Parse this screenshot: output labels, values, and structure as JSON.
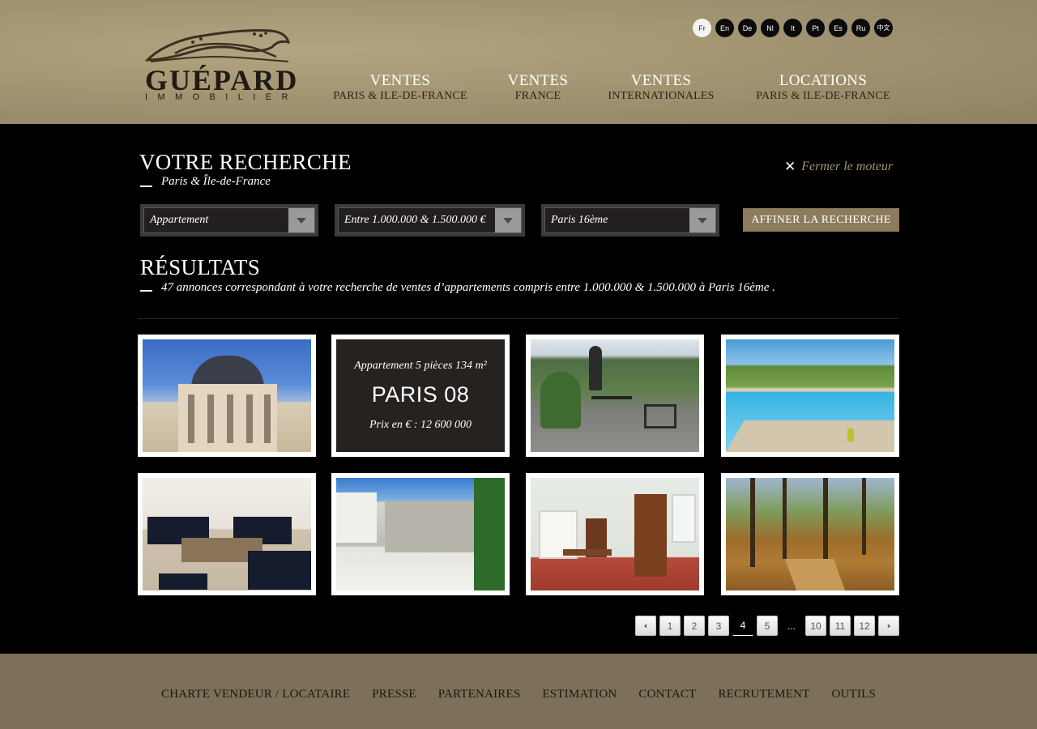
{
  "header": {
    "logo": {
      "name": "GUÉPARD",
      "tagline": "IMMOBILIER"
    },
    "languages": [
      {
        "code": "Fr",
        "active": true
      },
      {
        "code": "En",
        "active": false
      },
      {
        "code": "De",
        "active": false
      },
      {
        "code": "Nl",
        "active": false
      },
      {
        "code": "It",
        "active": false
      },
      {
        "code": "Pt",
        "active": false
      },
      {
        "code": "Es",
        "active": false
      },
      {
        "code": "Ru",
        "active": false
      },
      {
        "code": "中文",
        "active": false
      }
    ],
    "nav": [
      {
        "title": "VENTES",
        "subtitle": "PARIS & ILE-DE-FRANCE"
      },
      {
        "title": "VENTES",
        "subtitle": "FRANCE"
      },
      {
        "title": "VENTES",
        "subtitle": "INTERNATIONALES"
      },
      {
        "title": "LOCATIONS",
        "subtitle": "PARIS & ILE-DE-FRANCE"
      }
    ]
  },
  "search": {
    "title": "VOTRE RECHERCHE",
    "region": "Paris & Île-de-France",
    "close_label": "Fermer le moteur",
    "filters": {
      "type": "Appartement",
      "price": "Entre 1.000.000 & 1.500.000 €",
      "location": "Paris 16ème"
    },
    "refine_label": "AFFINER LA RECHERCHE"
  },
  "results": {
    "title": "RÉSULTATS",
    "summary": "47 annonces correspondant à votre recherche de ventes d’appartements compris entre 1.000.000 & 1.500.000 à Paris 16ème  .",
    "featured": {
      "description": "Appartement 5 pièces 134 m²",
      "location": "PARIS 08",
      "price": "Prix en € : 12 600 000"
    },
    "images": [
      "haussmann-building-photo",
      "featured-apartment-photo",
      "mountain-terrace-photo",
      "swimming-pool-photo",
      "living-room-photo",
      "stone-courtyard-photo",
      "antique-bedroom-photo",
      "forest-path-photo"
    ]
  },
  "pagination": {
    "prev": "‹",
    "pages": [
      "1",
      "2",
      "3",
      "4",
      "5"
    ],
    "current": "4",
    "ellipsis": "...",
    "last_pages": [
      "10",
      "11",
      "12"
    ],
    "next": "›"
  },
  "footer": {
    "links": [
      "CHARTE VENDEUR / LOCATAIRE",
      "PRESSE",
      "PARTENAIRES",
      "ESTIMATION",
      "CONTACT",
      "RECRUTEMENT",
      "OUTILS"
    ]
  },
  "colors": {
    "header_bg": "#a39472",
    "accent": "#8c7b5c",
    "footer_bg": "#7c7059",
    "close_text": "#a39472"
  }
}
